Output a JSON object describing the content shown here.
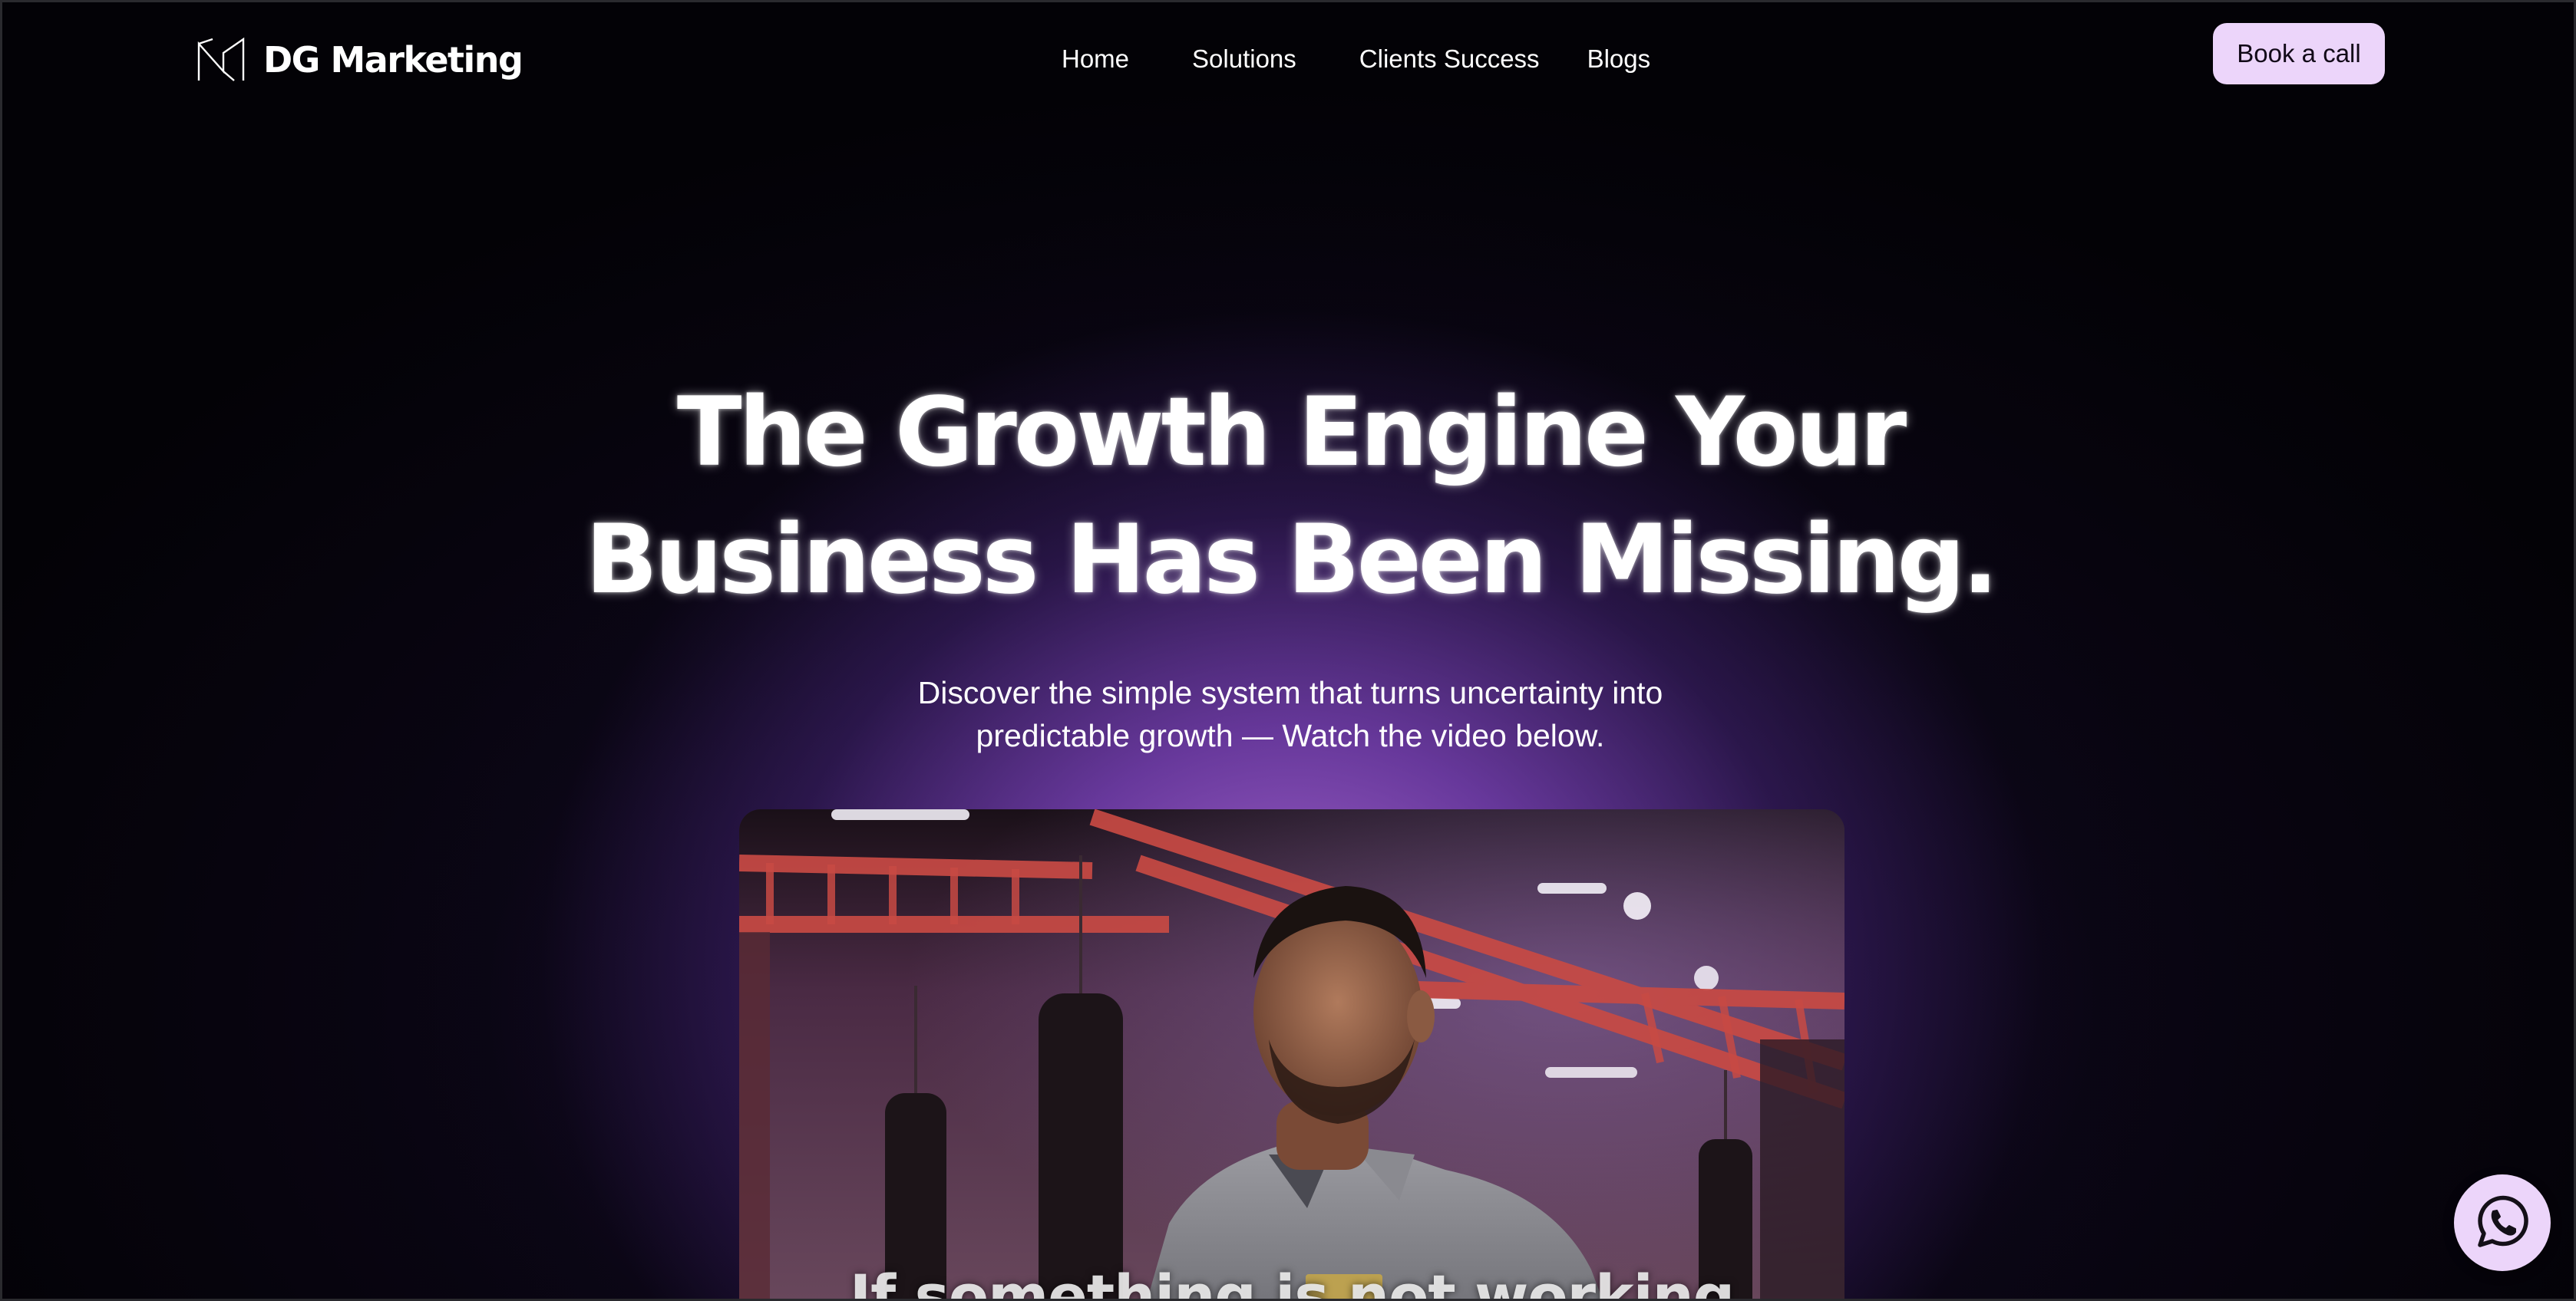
{
  "brand": {
    "name": "DG Marketing",
    "logo_icon": "m-monogram-icon"
  },
  "nav": {
    "links": [
      {
        "label": "Home"
      },
      {
        "label": "Solutions"
      },
      {
        "label": "Clients Success"
      },
      {
        "label": "Blogs"
      }
    ],
    "cta_label": "Book a call"
  },
  "hero": {
    "title_line1": "The Growth Engine Your",
    "title_line2": "Business Has Been Missing.",
    "subtitle_line1": "Discover the simple system that turns uncertainty into",
    "subtitle_line2": "predictable growth — Watch the video below."
  },
  "video": {
    "caption": "If something is not working"
  },
  "floating": {
    "icon": "whatsapp-icon"
  },
  "colors": {
    "background": "#030206",
    "glow": "#a868d2",
    "cta_background": "#ecd5fa",
    "cta_text": "#120a18",
    "text": "#ffffff"
  }
}
